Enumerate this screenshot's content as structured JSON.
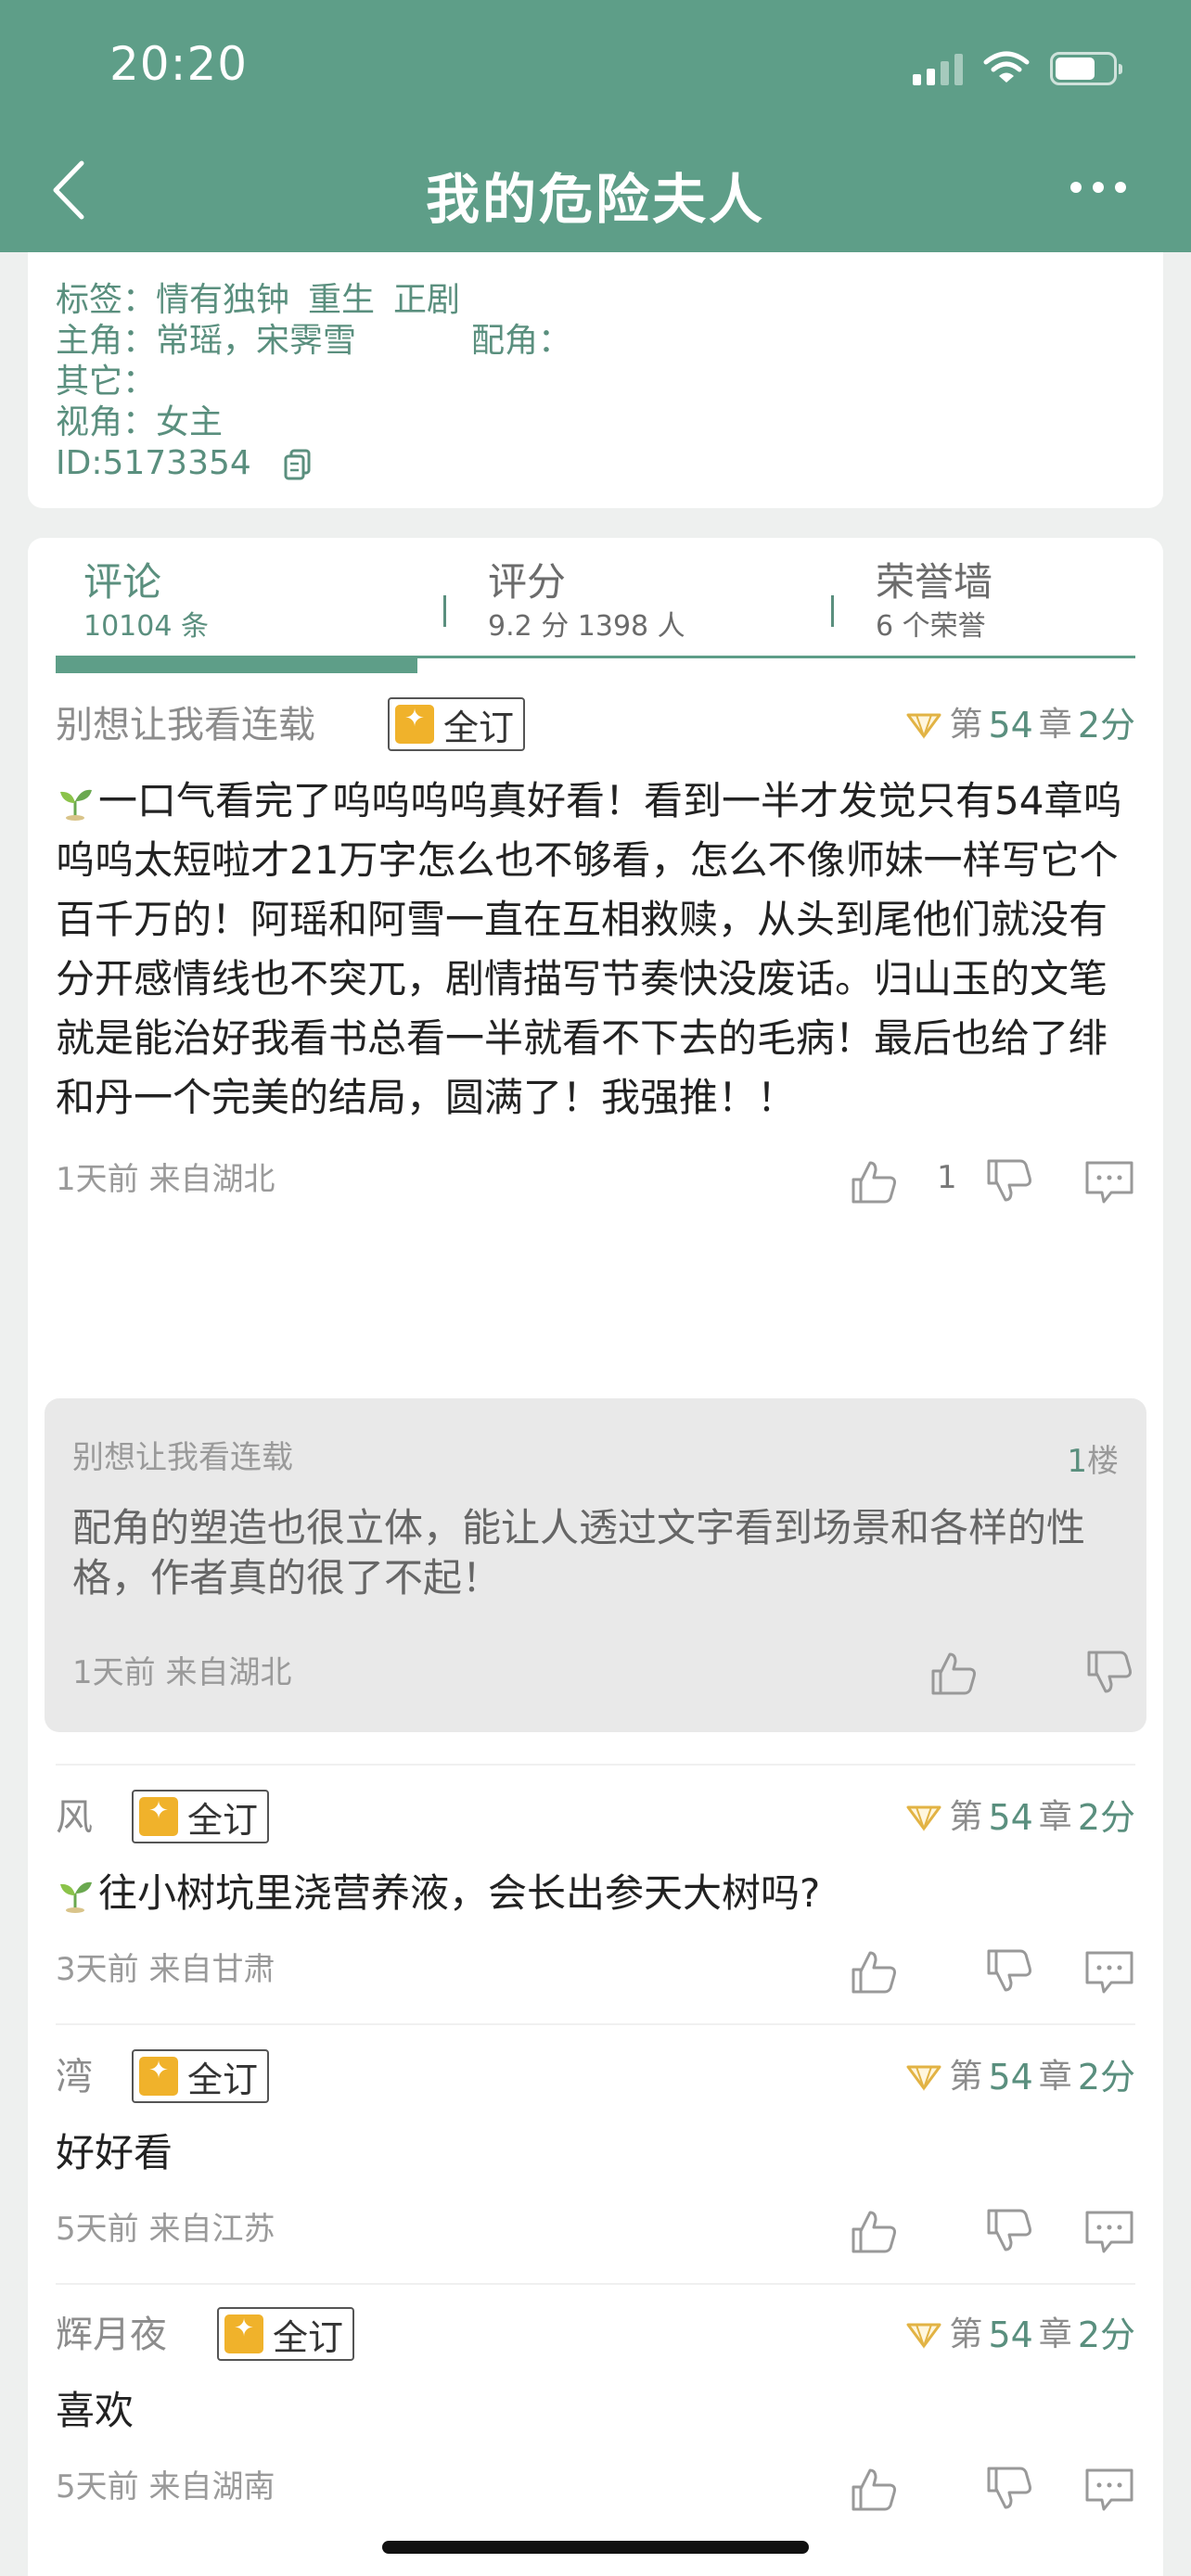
{
  "status_bar": {
    "time": "20:20"
  },
  "nav": {
    "title": "我的危险夫人"
  },
  "info": {
    "tags_label": "标签：",
    "tags": [
      "情有独钟",
      "重生",
      "正剧"
    ],
    "leads_label": "主角：",
    "leads": "常瑶，宋霁雪",
    "supporting_label": "配角：",
    "supporting": "",
    "other_label": "其它：",
    "other": "",
    "pov_label": "视角：",
    "pov": "女主",
    "id": "ID:5173354"
  },
  "tabs": [
    {
      "label": "评论",
      "sub": "10104 条"
    },
    {
      "label": "评分",
      "sub": "9.2 分 1398 人"
    },
    {
      "label": "荣誉墙",
      "sub": "6 个荣誉"
    }
  ],
  "badge_label": "全订",
  "chapter_prefix": "第",
  "chapter_mid": "章",
  "comments": [
    {
      "user": "别想让我看连载",
      "chapter": "54",
      "score": "2分",
      "text": "一口气看完了呜呜呜呜真好看！看到一半才发觉只有54章呜呜呜太短啦才21万字怎么也不够看，怎么不像师妹一样写它个百千万的！阿瑶和阿雪一直在互相救赎，从头到尾他们就没有分开感情线也不突兀，剧情描写节奏快没废话。归山玉的文笔就是能治好我看书总看一半就看不下去的毛病！最后也给了绯和丹一个完美的结局，圆满了！我强推！！",
      "meta": "1天前  来自湖北",
      "likes": "1"
    },
    {
      "user": "风",
      "chapter": "54",
      "score": "2分",
      "text": "往小树坑里浇营养液，会长出参天大树吗?",
      "meta": "3天前  来自甘肃"
    },
    {
      "user": "湾",
      "chapter": "54",
      "score": "2分",
      "text": "好好看",
      "meta": "5天前  来自江苏"
    },
    {
      "user": "辉月夜",
      "chapter": "54",
      "score": "2分",
      "text": "喜欢",
      "meta": "5天前  来自湖南"
    }
  ],
  "reply": {
    "user": "别想让我看连载",
    "floor_num": "1",
    "floor_unit": "楼",
    "text": "配角的塑造也很立体，能让人透过文字看到场景和各样的性格，作者真的很了不起！",
    "meta": "1天前  来自湖北"
  },
  "colors": {
    "primary": "#5e9e88",
    "accent_text": "#5a8f7e",
    "badge": "#f0b22b"
  }
}
